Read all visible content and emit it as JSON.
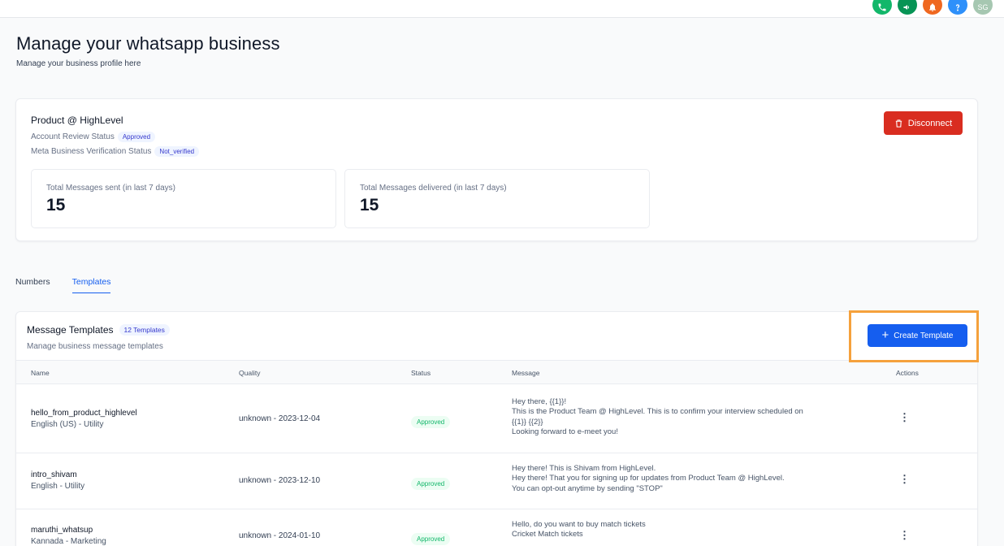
{
  "header": {
    "avatar_initials": "SG",
    "icons": [
      {
        "name": "phone-icon",
        "color": "#12b76a"
      },
      {
        "name": "megaphone-icon",
        "color": "#079455"
      },
      {
        "name": "bell-icon",
        "color": "#ef6820"
      },
      {
        "name": "help-icon",
        "color": "#2e90fa"
      }
    ],
    "avatar_color": "#a6c7b1"
  },
  "page": {
    "title": "Manage your whatsapp business",
    "subtitle": "Manage your business profile here"
  },
  "profile": {
    "business_name": "Product @ HighLevel",
    "account_review_label": "Account Review Status",
    "account_review_value": "Approved",
    "meta_verification_label": "Meta Business Verification Status",
    "meta_verification_value": "Not_verified",
    "disconnect_label": "Disconnect",
    "stats": [
      {
        "label": "Total Messages sent (in last 7 days)",
        "value": "15"
      },
      {
        "label": "Total Messages delivered (in last 7 days)",
        "value": "15"
      }
    ]
  },
  "tabs": [
    {
      "label": "Numbers",
      "active": false
    },
    {
      "label": "Templates",
      "active": true
    }
  ],
  "templates": {
    "title": "Message Templates",
    "count_badge": "12 Templates",
    "subtitle": "Manage business message templates",
    "create_label": "Create Template",
    "columns": [
      "Name",
      "Quality",
      "Status",
      "Message",
      "Actions"
    ],
    "rows": [
      {
        "name": "hello_from_product_highlevel",
        "lang": "English (US) - Utility",
        "quality": "unknown - 2023-12-04",
        "status": "Approved",
        "message": [
          "Hey there, {{1}}!",
          "This is the Product Team @ HighLevel. This is to confirm your interview scheduled on",
          "{{1}} {{2}}",
          "Looking forward to e-meet you!"
        ]
      },
      {
        "name": "intro_shivam",
        "lang": "English - Utility",
        "quality": "unknown - 2023-12-10",
        "status": "Approved",
        "message": [
          "Hey there! This is Shivam from HighLevel.",
          "Hey there! That you for signing up for updates from Product Team @ HighLevel.",
          "You can opt-out anytime by sending \"STOP\""
        ]
      },
      {
        "name": "maruthi_whatsup",
        "lang": "Kannada - Marketing",
        "quality": "unknown - 2024-01-10",
        "status": "Approved",
        "message": [
          "Hello, do you want to buy match tickets",
          "Cricket Match tickets"
        ]
      }
    ]
  }
}
